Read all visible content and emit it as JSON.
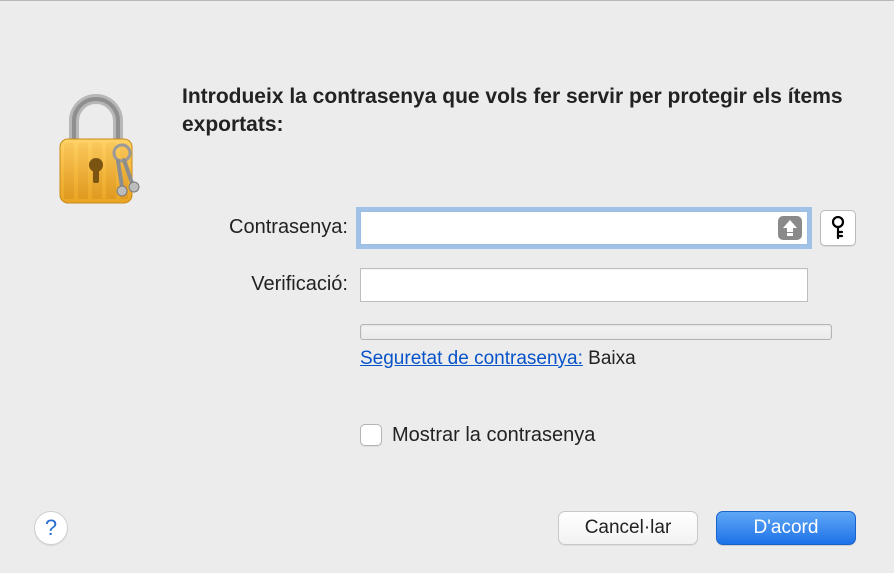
{
  "heading": "Introdueix la contrasenya que vols fer servir per protegir els ítems exportats:",
  "labels": {
    "password": "Contrasenya:",
    "verify": "Verificació:"
  },
  "strength": {
    "link_text": "Seguretat de contrasenya:",
    "value": "Baixa"
  },
  "show_password_label": "Mostrar la contrasenya",
  "buttons": {
    "cancel": "Cancel·lar",
    "ok": "D'acord"
  },
  "help_glyph": "?"
}
